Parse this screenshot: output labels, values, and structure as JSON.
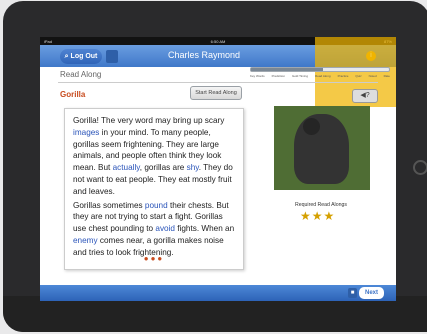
{
  "status": {
    "device": "iPad",
    "time": "6:50 AM",
    "battery": "87%"
  },
  "topbar": {
    "logout": "Log Out",
    "student": "Charles Raymond",
    "info": "i"
  },
  "section": {
    "title": "Read Along"
  },
  "progress": {
    "steps": [
      "Key Words",
      "Prediction",
      "Gold Timing",
      "Read Along",
      "Practice",
      "Quiz",
      "Noted",
      "Rate"
    ],
    "current_step_fraction": 0.52
  },
  "lesson": {
    "title": "Gorilla",
    "start_label": "Start Read Along",
    "audio_label": "◀?"
  },
  "reading": {
    "p1": {
      "a": "Gorilla! The very word may bring up scary ",
      "vocab1": "images",
      "b": " in your mind. To many people, gorillas seem frightening. They are large animals, and people often think they look mean. But ",
      "vocab2": "actually",
      "c": ", gorillas are ",
      "vocab3": "shy",
      "d": ". They do not want to eat people. They eat mostly fruit and leaves."
    },
    "p2": {
      "a": "Gorillas sometimes ",
      "vocab1": "pound",
      "b": " their chests. But they are not trying to start a fight. Gorillas use chest pounding to ",
      "vocab2": "avoid",
      "c": " fights. When an ",
      "vocab3": "enemy",
      "d": " comes near, a gorilla makes noise and tries to look frightening."
    }
  },
  "pagination": {
    "dots": "●●●"
  },
  "requirements": {
    "label": "Required Read Alongs",
    "stars": "★★★"
  },
  "bottombar": {
    "next": "Next",
    "square": "■"
  }
}
